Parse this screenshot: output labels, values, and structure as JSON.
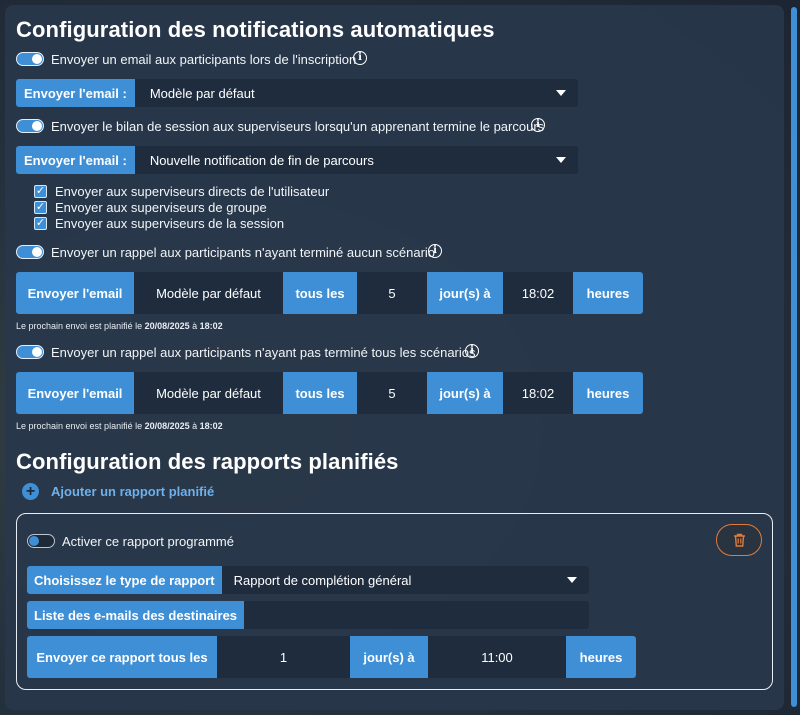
{
  "section1_title": "Configuration des notifications automatiques",
  "notif1": {
    "label": "Envoyer un email aux participants lors de l'inscription",
    "select_tag": "Envoyer l'email :",
    "select_value": "Modèle par défaut"
  },
  "notif2": {
    "label": "Envoyer le bilan de session aux superviseurs lorsqu'un apprenant termine le parcours",
    "select_tag": "Envoyer l'email :",
    "select_value": "Nouvelle notification de fin de parcours",
    "checkboxes": [
      "Envoyer aux superviseurs directs de l'utilisateur",
      "Envoyer aux superviseurs de groupe",
      "Envoyer aux superviseurs de la session"
    ]
  },
  "reminder1": {
    "label": "Envoyer un rappel aux participants n'ayant terminé aucun scénario",
    "send_email": "Envoyer l'email",
    "template": "Modèle par défaut",
    "every": "tous les",
    "count": "5",
    "days_at": "jour(s) à",
    "time": "18:02",
    "hours": "heures",
    "next_prefix": "Le prochain envoi est planifié le ",
    "next_date": "20/08/2025",
    "next_mid": " à ",
    "next_time": "18:02"
  },
  "reminder2": {
    "label": "Envoyer un rappel aux participants n'ayant pas terminé tous les scénarios",
    "send_email": "Envoyer l'email",
    "template": "Modèle par défaut",
    "every": "tous les",
    "count": "5",
    "days_at": "jour(s) à",
    "time": "18:02",
    "hours": "heures",
    "next_prefix": "Le prochain envoi est planifié le ",
    "next_date": "20/08/2025",
    "next_mid": " à ",
    "next_time": "18:02"
  },
  "section2_title": "Configuration des rapports planifiés",
  "add_report": "Ajouter un rapport planifié",
  "report": {
    "activate_label": "Activer ce rapport programmé",
    "type_tag": "Choisissez le type de rapport",
    "type_value": "Rapport de complétion général",
    "emails_tag": "Liste des e-mails des destinaires",
    "emails_value": "",
    "send_every": "Envoyer ce rapport tous les",
    "count": "1",
    "days_at": "jour(s) à",
    "time": "11:00",
    "hours": "heures"
  },
  "colors": {
    "accent": "#3e8fd6",
    "field": "#1e2c3e",
    "panel": "#28374a",
    "danger": "#e07b39"
  }
}
